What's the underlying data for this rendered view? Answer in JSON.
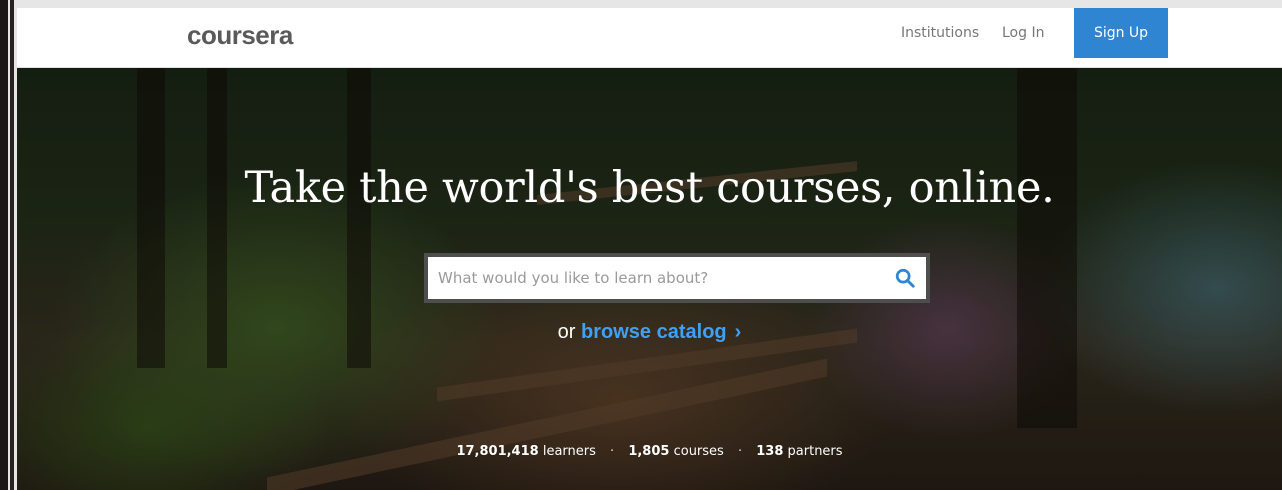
{
  "header": {
    "logo": "coursera",
    "nav": {
      "institutions": "Institutions",
      "login": "Log In",
      "signup": "Sign Up"
    }
  },
  "hero": {
    "headline": "Take the world's best courses, online.",
    "search": {
      "placeholder": "What would you like to learn about?"
    },
    "browse": {
      "prefix": "or",
      "link": "browse catalog",
      "chevron": "›"
    },
    "stats": {
      "learners_value": "17,801,418",
      "learners_label": "learners",
      "courses_value": "1,805",
      "courses_label": "courses",
      "partners_value": "138",
      "partners_label": "partners",
      "separator": "·"
    }
  },
  "colors": {
    "accent": "#2f85d2",
    "link": "#3fa0f5"
  },
  "icons": {
    "search": "search-icon",
    "browse_chevron": "chevron-right-icon"
  }
}
